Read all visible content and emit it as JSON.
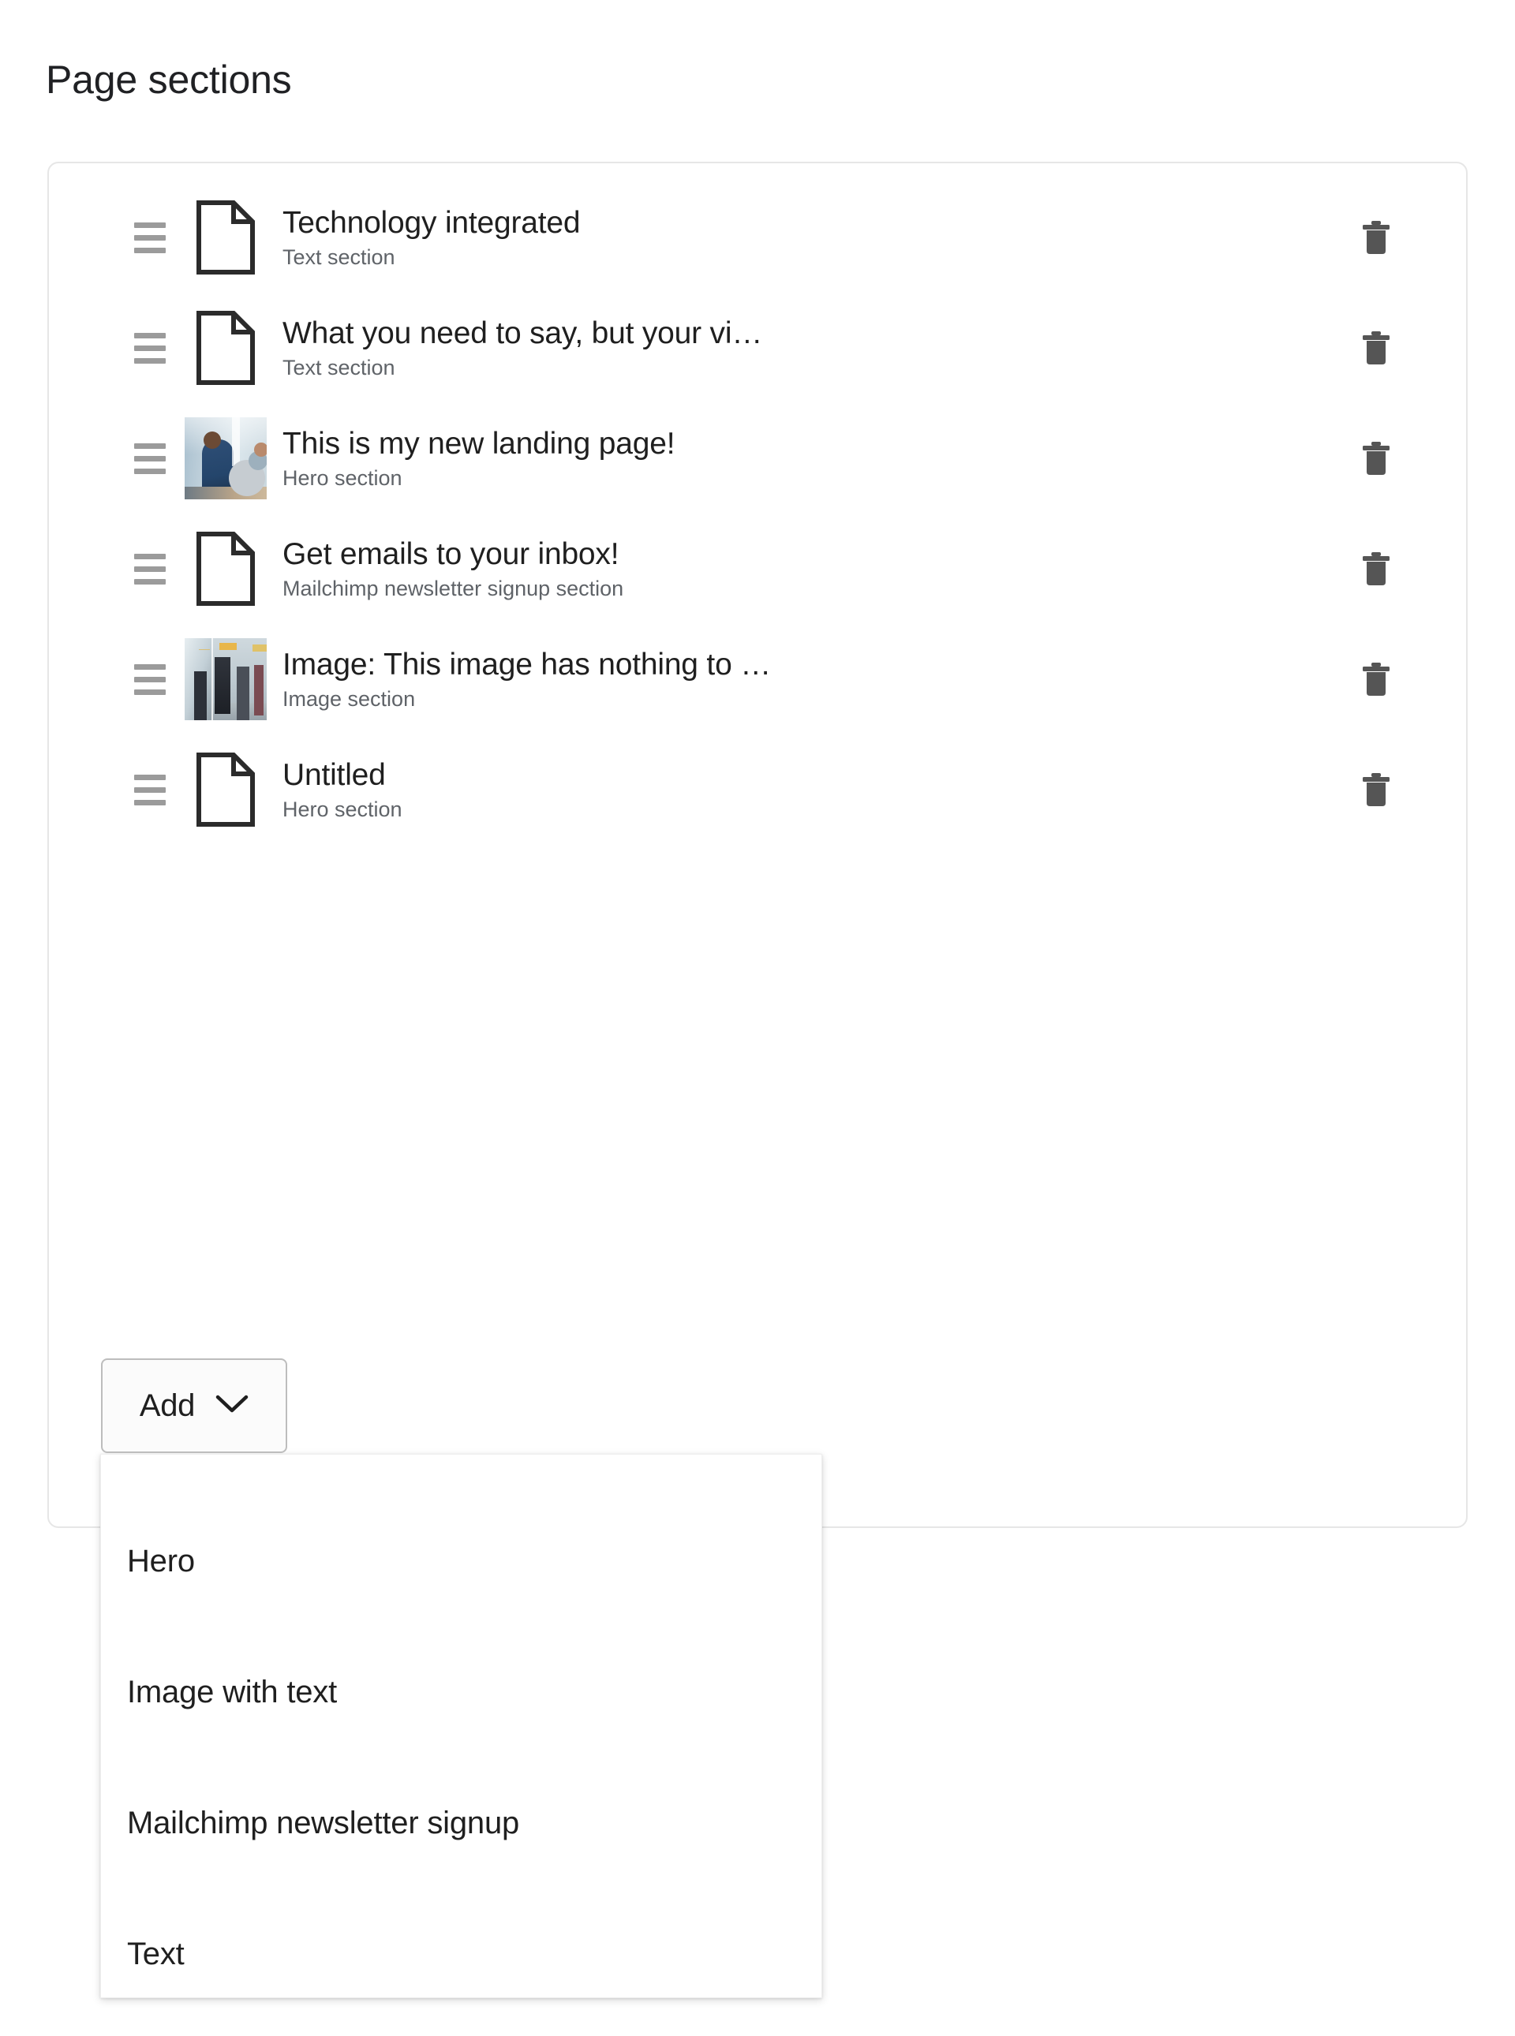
{
  "page": {
    "title": "Page sections"
  },
  "sections": [
    {
      "title": "Technology integrated",
      "subtitle": "Text section",
      "icon": "document-icon",
      "thumbnail": null,
      "drag_handle": "drag-handle-icon",
      "delete": "trash-icon"
    },
    {
      "title": "What you need to say, but your vi…",
      "subtitle": "Text section",
      "icon": "document-icon",
      "thumbnail": null,
      "drag_handle": "drag-handle-icon",
      "delete": "trash-icon"
    },
    {
      "title": "This is my new landing page!",
      "subtitle": "Hero section",
      "icon": "image-thumbnail",
      "thumbnail": "two-men-with-laptop-in-office",
      "drag_handle": "drag-handle-icon",
      "delete": "trash-icon"
    },
    {
      "title": "Get emails to your inbox!",
      "subtitle": "Mailchimp newsletter signup section",
      "icon": "document-icon",
      "thumbnail": null,
      "drag_handle": "drag-handle-icon",
      "delete": "trash-icon"
    },
    {
      "title": "Image: This image has nothing to …",
      "subtitle": "Image section",
      "icon": "image-thumbnail",
      "thumbnail": "commuters-on-train-platform",
      "drag_handle": "drag-handle-icon",
      "delete": "trash-icon"
    },
    {
      "title": "Untitled",
      "subtitle": "Hero section",
      "icon": "document-icon",
      "thumbnail": null,
      "drag_handle": "drag-handle-icon",
      "delete": "trash-icon"
    }
  ],
  "add_button": {
    "label": "Add",
    "chevron": "chevron-down-icon",
    "expanded": true
  },
  "add_menu": {
    "items": [
      {
        "label": "Hero"
      },
      {
        "label": "Image with text"
      },
      {
        "label": "Mailchimp newsletter signup"
      },
      {
        "label": "Text"
      }
    ]
  },
  "colors": {
    "text_primary": "#1f1f1f",
    "text_secondary": "#5f6368",
    "card_border": "#e6e6e6",
    "button_border": "#bdbdbd",
    "drag_handle": "#9b9b9b",
    "trash": "#555555",
    "background": "#ffffff"
  }
}
